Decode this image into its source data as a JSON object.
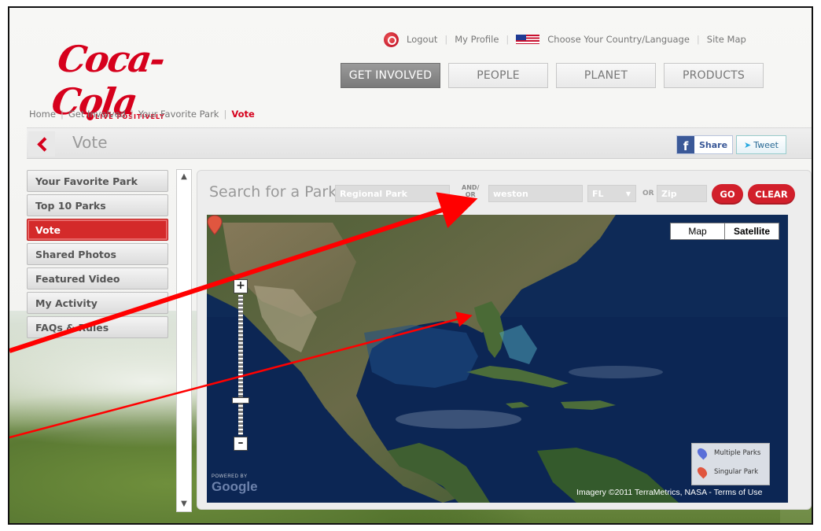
{
  "brand": {
    "logo_text": "Coca-Cola",
    "tagline": "LIVE POSITIVELY",
    "color": "#d6001c"
  },
  "utility_links": {
    "logout": "Logout",
    "my_profile": "My Profile",
    "country_language": "Choose Your Country/Language",
    "site_map": "Site Map"
  },
  "nav": {
    "tabs": [
      "GET INVOLVED",
      "PEOPLE",
      "PLANET",
      "PRODUCTS"
    ],
    "active": "GET INVOLVED"
  },
  "breadcrumb": {
    "items": [
      "Home",
      "Get Involved",
      "Your Favorite Park"
    ],
    "current": "Vote"
  },
  "title_bar": {
    "title": "Vote",
    "share_label": "Share",
    "tweet_label": "Tweet"
  },
  "sidebar": {
    "items": [
      "Your Favorite Park",
      "Top 10 Parks",
      "Vote",
      "Shared Photos",
      "Featured Video",
      "My Activity",
      "FAQs & Rules"
    ],
    "active": "Vote"
  },
  "search": {
    "label": "Search for a Park",
    "park_name_value": "Regional Park",
    "and_or_top": "AND/",
    "and_or_bottom": "OR",
    "city_value": "weston",
    "state_value": "FL",
    "or_text": "OR",
    "zip_placeholder": "Zip",
    "go_label": "GO",
    "clear_label": "CLEAR"
  },
  "map": {
    "map_type_map": "Map",
    "map_type_satellite": "Satellite",
    "legend": {
      "multiple": "Multiple Parks",
      "singular": "Singular Park"
    },
    "powered_by": "POWERED BY",
    "google": "Google",
    "attribution": "Imagery ©2011  TerraMetrics, NASA - Terms of Use",
    "zoom_in": "+",
    "zoom_out": "–"
  },
  "icons": {
    "logout": "logout-icon",
    "flag": "us-flag-icon",
    "back": "chevron-left-icon",
    "facebook": "facebook-icon",
    "twitter": "twitter-bird-icon",
    "map_pin": "map-pin-icon"
  }
}
